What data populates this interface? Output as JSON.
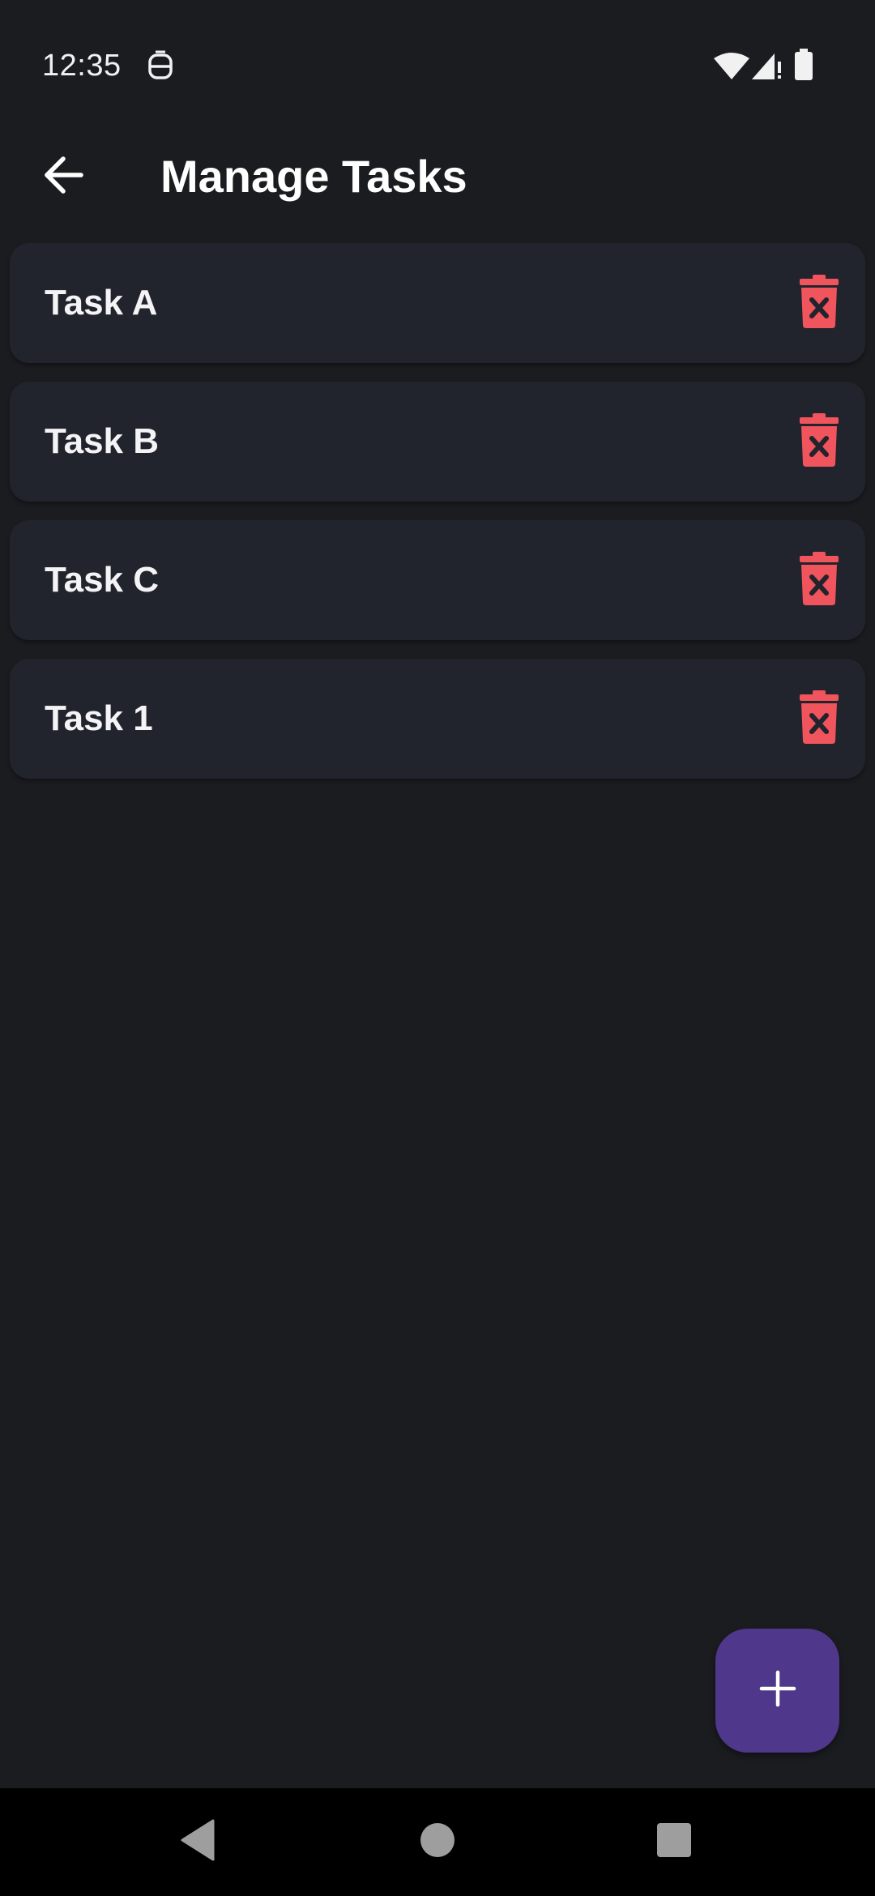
{
  "status_bar": {
    "time": "12:35",
    "notification_icon": "accessibility-icon",
    "icons": [
      "wifi-icon",
      "signal-icon",
      "battery-icon"
    ]
  },
  "app_bar": {
    "title": "Manage Tasks",
    "back_icon": "arrow-left-icon"
  },
  "tasks": [
    {
      "label": "Task A",
      "delete_icon": "trash-x-icon"
    },
    {
      "label": "Task B",
      "delete_icon": "trash-x-icon"
    },
    {
      "label": "Task C",
      "delete_icon": "trash-x-icon"
    },
    {
      "label": "Task 1",
      "delete_icon": "trash-x-icon"
    }
  ],
  "fab": {
    "icon": "plus-icon"
  },
  "nav": {
    "items": [
      "back-triangle-icon",
      "home-circle-icon",
      "recents-square-icon"
    ]
  },
  "colors": {
    "background": "#1b1c20",
    "card": "#22242d",
    "delete": "#f0545c",
    "fab": "#4f378b",
    "nav_bar": "#000000"
  }
}
